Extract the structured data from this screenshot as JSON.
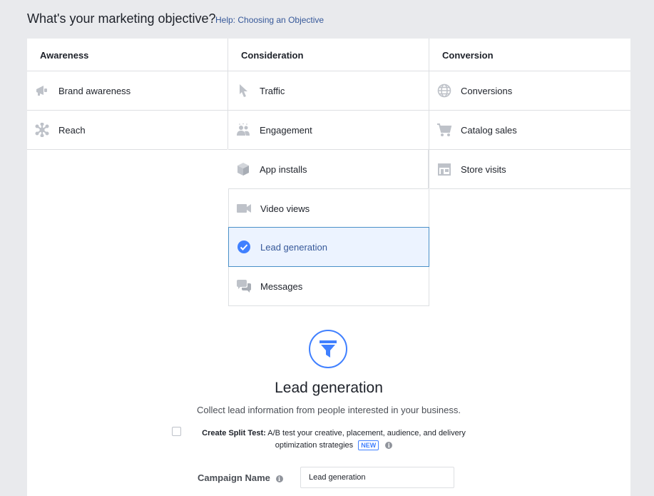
{
  "header": {
    "title": "What's your marketing objective?",
    "help_link": "Help: Choosing an Objective"
  },
  "columns": {
    "awareness": {
      "title": "Awareness",
      "items": [
        {
          "label": "Brand awareness",
          "icon": "megaphone-icon"
        },
        {
          "label": "Reach",
          "icon": "reach-icon"
        }
      ]
    },
    "consideration": {
      "title": "Consideration",
      "items": [
        {
          "label": "Traffic",
          "icon": "cursor-icon"
        },
        {
          "label": "Engagement",
          "icon": "people-icon"
        },
        {
          "label": "App installs",
          "icon": "cube-icon"
        },
        {
          "label": "Video views",
          "icon": "video-camera-icon"
        },
        {
          "label": "Lead generation",
          "icon": "checkmark-icon",
          "selected": true
        },
        {
          "label": "Messages",
          "icon": "chat-bubbles-icon"
        }
      ]
    },
    "conversion": {
      "title": "Conversion",
      "items": [
        {
          "label": "Conversions",
          "icon": "globe-icon"
        },
        {
          "label": "Catalog sales",
          "icon": "cart-icon"
        },
        {
          "label": "Store visits",
          "icon": "store-icon"
        }
      ]
    }
  },
  "detail": {
    "icon": "funnel-icon",
    "title": "Lead generation",
    "description": "Collect lead information from people interested in your business."
  },
  "split_test": {
    "label": "Create Split Test:",
    "description_line1": "A/B test your creative, placement, audience, and delivery",
    "description_line2": "optimization strategies",
    "badge": "NEW",
    "info": "i"
  },
  "campaign": {
    "label": "Campaign Name",
    "info": "i",
    "value": "Lead generation"
  },
  "colors": {
    "accent": "#4080ff",
    "link": "#365899",
    "selected_bg": "#ecf3ff",
    "icon_gray": "#bec2c9"
  }
}
